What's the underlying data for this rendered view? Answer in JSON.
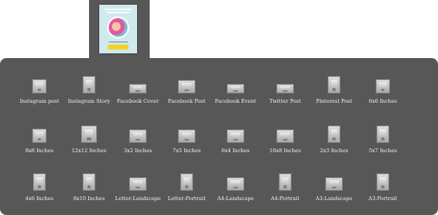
{
  "current_design": {
    "preview_icon": "design-thumbnail"
  },
  "sizes": [
    {
      "label": "Instagram post",
      "shape": "square"
    },
    {
      "label": "Instagram Story",
      "shape": "portrait"
    },
    {
      "label": "Facebook Cover",
      "shape": "landscape"
    },
    {
      "label": "Facebook Post",
      "shape": "wide"
    },
    {
      "label": "Facebook Event",
      "shape": "landscape"
    },
    {
      "label": "Twitter Post",
      "shape": "landscape"
    },
    {
      "label": "Pinterest Post",
      "shape": "portrait"
    },
    {
      "label": "6x6 Inches",
      "shape": "square"
    },
    {
      "label": "8x8 Inches",
      "shape": "square"
    },
    {
      "label": "12x12 Inches",
      "shape": "square-lg"
    },
    {
      "label": "3x2 Inches",
      "shape": "wide"
    },
    {
      "label": "7x5 Inches",
      "shape": "wide"
    },
    {
      "label": "6x4 Inches",
      "shape": "wide"
    },
    {
      "label": "10x8 Inches",
      "shape": "wide"
    },
    {
      "label": "2x3 Inches",
      "shape": "portrait"
    },
    {
      "label": "5x7 Inches",
      "shape": "portrait"
    },
    {
      "label": "4x6 Inches",
      "shape": "portrait"
    },
    {
      "label": "8x10 Inches",
      "shape": "portrait"
    },
    {
      "label": "Letter-Landscape",
      "shape": "wide"
    },
    {
      "label": "Letter-Portrait",
      "shape": "portrait"
    },
    {
      "label": "A4-Landscape",
      "shape": "wide"
    },
    {
      "label": "A4-Portrait",
      "shape": "portrait"
    },
    {
      "label": "A3-Landscape",
      "shape": "wide"
    },
    {
      "label": "A3-Portrait",
      "shape": "portrait"
    }
  ]
}
